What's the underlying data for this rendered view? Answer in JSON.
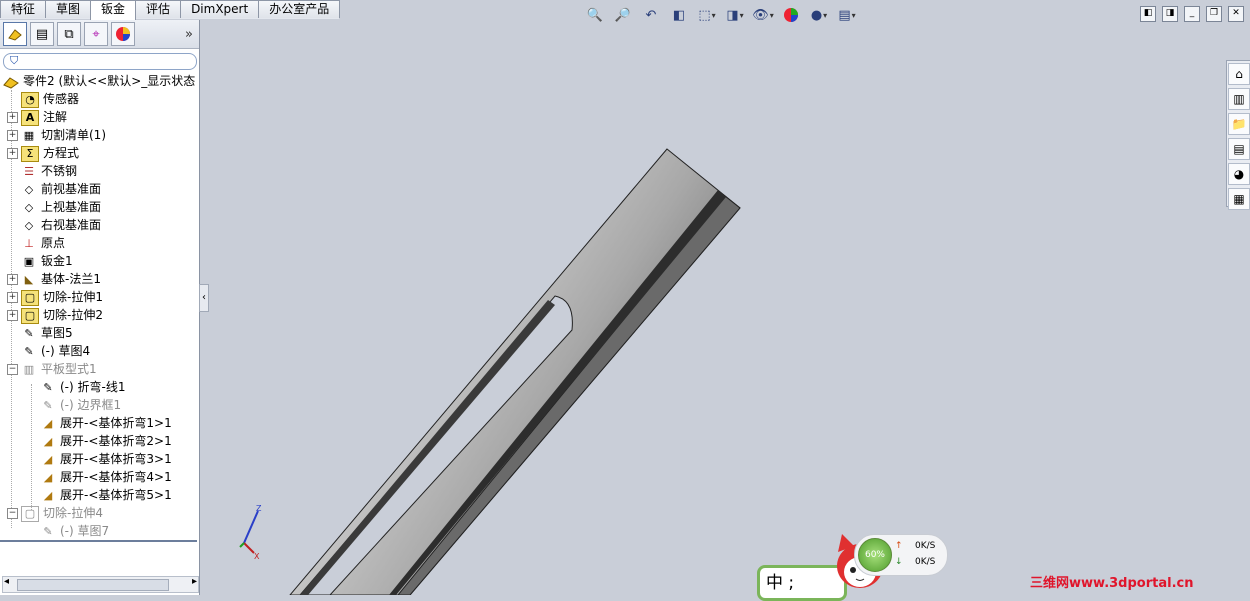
{
  "tabs": [
    {
      "label": "特征",
      "active": false
    },
    {
      "label": "草图",
      "active": false
    },
    {
      "label": "钣金",
      "active": true
    },
    {
      "label": "评估",
      "active": false
    },
    {
      "label": "DimXpert",
      "active": false
    },
    {
      "label": "办公室产品",
      "active": false
    }
  ],
  "panel": {
    "tab_icons": [
      "featuremanager-icon",
      "propertymanager-icon",
      "configurationmanager-icon",
      "dimxpert-icon",
      "display-manager-icon"
    ],
    "expand_glyph": "»",
    "filter_glyph": "⛉"
  },
  "tree": {
    "root": "零件2   (默认<<默认>_显示状态",
    "items": [
      {
        "label": "传感器",
        "icon": "sensor-icon"
      },
      {
        "label": "注解",
        "icon": "annotation-icon"
      },
      {
        "label": "切割清单(1)",
        "icon": "cutlist-icon"
      },
      {
        "label": "方程式",
        "icon": "equation-icon"
      },
      {
        "label": "不锈钢",
        "icon": "material-icon"
      },
      {
        "label": "前视基准面",
        "icon": "plane-icon"
      },
      {
        "label": "上视基准面",
        "icon": "plane-icon"
      },
      {
        "label": "右视基准面",
        "icon": "plane-icon"
      },
      {
        "label": "原点",
        "icon": "origin-icon"
      },
      {
        "label": "钣金1",
        "icon": "sheetmetal-icon"
      },
      {
        "label": "基体-法兰1",
        "icon": "base-flange-icon"
      },
      {
        "label": "切除-拉伸1",
        "icon": "cut-extrude-icon"
      },
      {
        "label": "切除-拉伸2",
        "icon": "cut-extrude-icon"
      },
      {
        "label": "草图5",
        "icon": "sketch-icon"
      },
      {
        "label": "(-) 草图4",
        "icon": "sketch-icon"
      },
      {
        "label": "平板型式1",
        "icon": "flat-pattern-icon"
      },
      {
        "label": "(-) 折弯-线1",
        "icon": "sketch-icon"
      },
      {
        "label": "(-) 边界框1",
        "icon": "sketch-icon"
      },
      {
        "label": "展开-<基体折弯1>1",
        "icon": "flatten-bend-icon"
      },
      {
        "label": "展开-<基体折弯2>1",
        "icon": "flatten-bend-icon"
      },
      {
        "label": "展开-<基体折弯3>1",
        "icon": "flatten-bend-icon"
      },
      {
        "label": "展开-<基体折弯4>1",
        "icon": "flatten-bend-icon"
      },
      {
        "label": "展开-<基体折弯5>1",
        "icon": "flatten-bend-icon"
      },
      {
        "label": "切除-拉伸4",
        "icon": "cut-extrude-icon"
      },
      {
        "label": "(-) 草图7",
        "icon": "sketch-icon"
      }
    ]
  },
  "hud_icons": [
    "zoom-to-fit-icon",
    "zoom-to-area-icon",
    "previous-view-icon",
    "section-view-icon",
    "view-orientation-icon",
    "display-style-icon",
    "hide-show-icon",
    "appearance-icon",
    "scene-icon",
    "view-settings-icon"
  ],
  "task_pane_icons": [
    "solidworks-resources-icon",
    "design-library-icon",
    "file-explorer-icon",
    "view-palette-icon",
    "appearances-icon",
    "custom-properties-icon"
  ],
  "network": {
    "percent": "60%",
    "up_arrow": "↑",
    "down_arrow": "↓",
    "up_speed": "0K/S",
    "down_speed": "0K/S"
  },
  "ime": {
    "text": "中 ;"
  },
  "triad": {
    "z_label": "Z",
    "x_label": "X"
  },
  "watermark": "三维网www.3dportal.cn",
  "colors": {
    "viewport": "#c9ced8",
    "active_tab": "#ffffff",
    "watermark": "#e0152b",
    "accent": "#1f4fa8"
  }
}
